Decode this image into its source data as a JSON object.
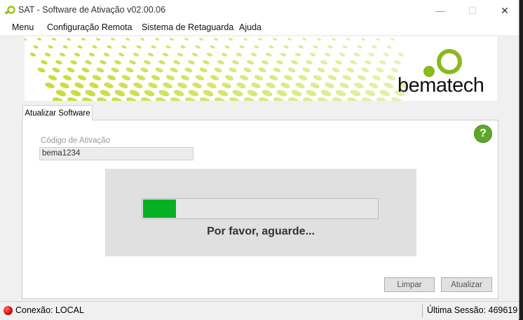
{
  "window": {
    "title": "SAT - Software de Ativação v02.00.06",
    "minimize": "—",
    "maximize": "☐",
    "close": "✕"
  },
  "menu": {
    "items": [
      "Menu",
      "Configuração Remota",
      "Sistema de Retaguarda",
      "Ajuda"
    ]
  },
  "banner": {
    "brand": "bematech",
    "accent_color": "#c8dc3c"
  },
  "tabs": [
    "Atualizar Software"
  ],
  "form": {
    "activation_label": "Código de Ativação",
    "activation_value": "bema1234",
    "help_label": "?"
  },
  "progress": {
    "fraction": 0.14,
    "message": "Por favor, aguarde...",
    "color": "#06b025"
  },
  "buttons": {
    "clear": "Limpar",
    "update": "Atualizar"
  },
  "status": {
    "connection": "Conexão: LOCAL",
    "session": "Última Sessão: 469619"
  }
}
